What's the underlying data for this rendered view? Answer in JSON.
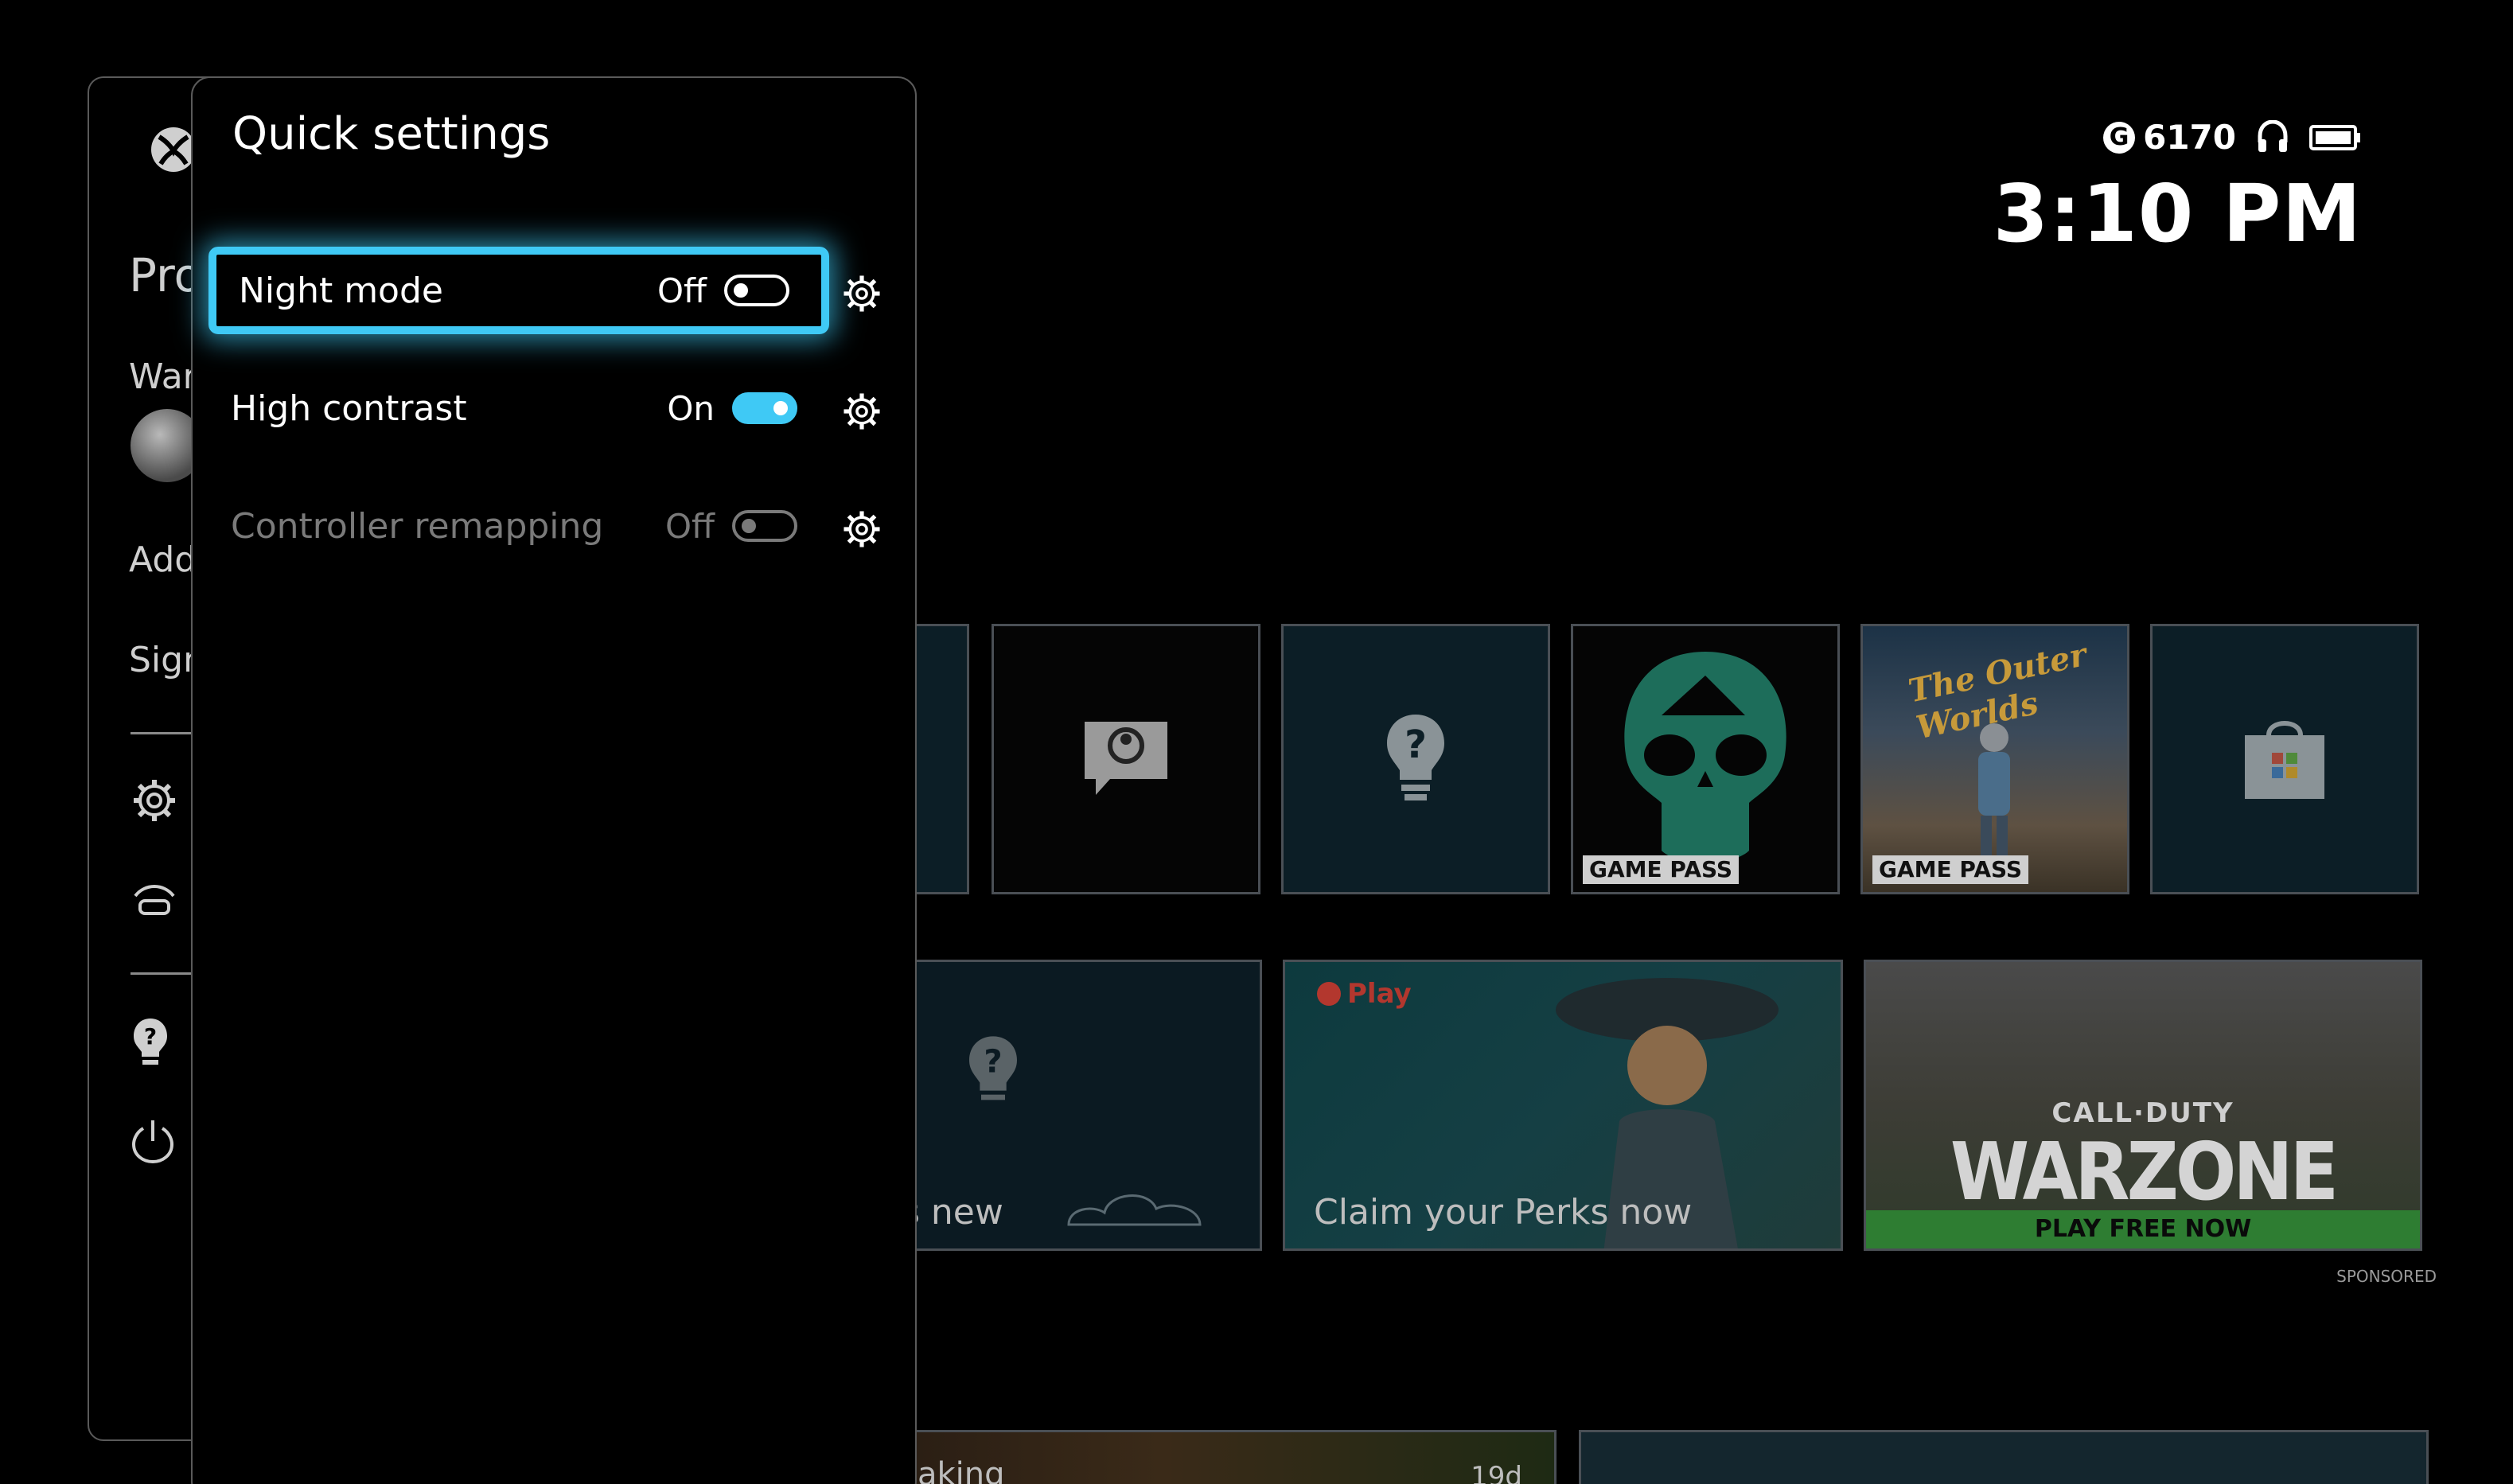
{
  "status": {
    "gamerscore": "6170",
    "g_badge": "G",
    "time": "3:10 PM",
    "icons": [
      "headset-icon",
      "battery-icon"
    ]
  },
  "sidebar": {
    "title_partial": "Pro",
    "gamertag_partial": "War",
    "add_partial": "Add",
    "sign_partial": "Sign",
    "icons": [
      "xbox-logo-icon",
      "gear-icon",
      "remote-play-icon",
      "tips-icon",
      "power-icon"
    ]
  },
  "quick_settings": {
    "title": "Quick settings",
    "items": [
      {
        "label": "Night mode",
        "state": "Off",
        "on": false,
        "enabled": true,
        "focused": true
      },
      {
        "label": "High contrast",
        "state": "On",
        "on": true,
        "enabled": true,
        "focused": false
      },
      {
        "label": "Controller remapping",
        "state": "Off",
        "on": false,
        "enabled": false,
        "focused": false
      }
    ]
  },
  "dashboard": {
    "tiles_row1": [
      {
        "name": "partial-tile",
        "icon": ""
      },
      {
        "name": "feedback-tile",
        "icon": "feedback-icon"
      },
      {
        "name": "tips-tile",
        "icon": "tips-icon"
      },
      {
        "name": "sea-of-thieves-tile",
        "badge": "GAME PASS",
        "icon": "skull-icon"
      },
      {
        "name": "outer-worlds-tile",
        "badge": "GAME PASS",
        "title_text": "The Outer Worlds"
      },
      {
        "name": "store-tile",
        "icon": "store-bag-icon"
      }
    ],
    "whats_new_caption": "s new",
    "perks": {
      "tag": "Play",
      "caption": "Claim your Perks now"
    },
    "warzone": {
      "top": "CALL·DUTY",
      "title": "WARZONE",
      "bar": "PLAY FREE NOW"
    },
    "sponsored": "SPONSORED",
    "bottom_partial_text": "aking",
    "bottom_partial_days": "19d"
  },
  "colors": {
    "accent": "#3fc9f5",
    "tile_bg": "#0c1e26",
    "green": "#2e7d32"
  }
}
